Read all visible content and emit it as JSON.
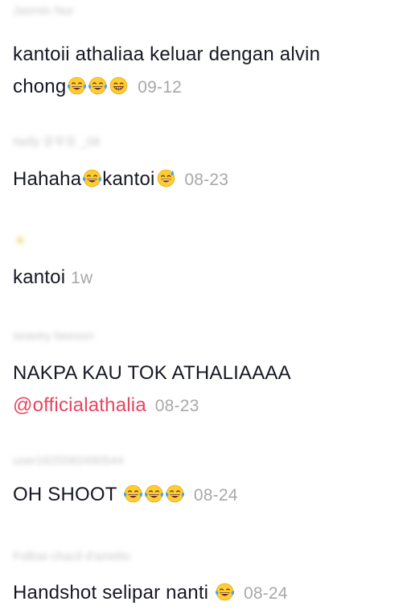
{
  "comments": [
    {
      "username": "Jasmin Nur",
      "text_lines": [
        "kantoii athaliaa keluar dengan alvin",
        "chong"
      ],
      "emojis": [
        "face-with-tears-of-joy",
        "face-with-tears-of-joy",
        "grinning-face-with-smiling-eyes"
      ],
      "time": "09-12"
    },
    {
      "username": "Nelly 유우유 _08",
      "text_before": "Hahaha",
      "text_middle": "kantoi",
      "emojis": [
        "face-with-tears-of-joy",
        "grinning-face-with-sweat"
      ],
      "time": "08-23"
    },
    {
      "username": "☀",
      "text": "kantoi",
      "time": "1w"
    },
    {
      "username": "seavey beeson",
      "text": "NAKPA KAU TOK ATHALIAAAA",
      "mention": "@officialathalia",
      "time": "08-23"
    },
    {
      "username": "user1625583490544",
      "text": "OH SHOOT ",
      "emojis": [
        "face-with-tears-of-joy",
        "face-with-tears-of-joy",
        "face-with-tears-of-joy"
      ],
      "time": "08-24"
    },
    {
      "username": "Follow chacil d'amelio",
      "text": "Handshot selipar nanti ",
      "emojis": [
        "face-with-tears-of-joy"
      ],
      "time": "08-24"
    }
  ]
}
